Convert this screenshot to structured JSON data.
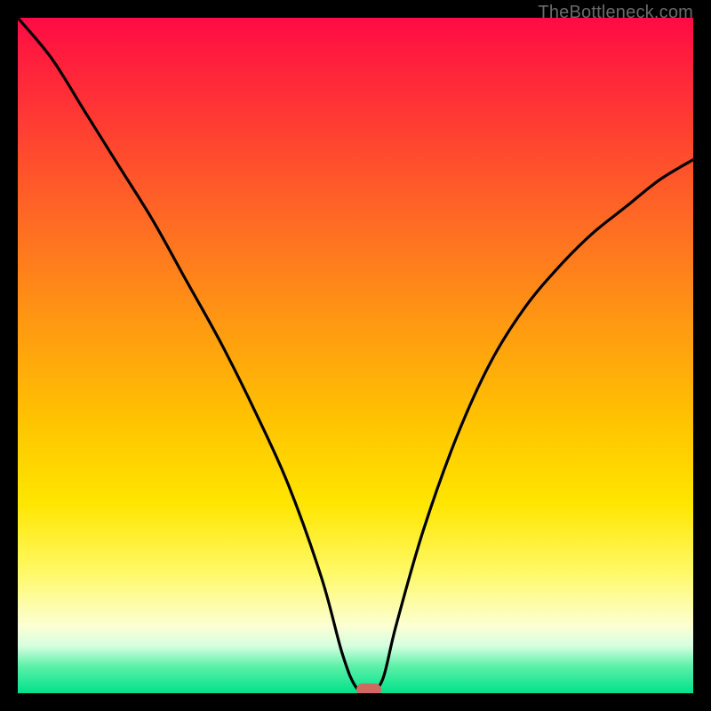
{
  "watermark": "TheBottleneck.com",
  "chart_data": {
    "type": "line",
    "title": "",
    "xlabel": "",
    "ylabel": "",
    "xlim": [
      0,
      100
    ],
    "ylim": [
      0,
      100
    ],
    "grid": false,
    "legend": false,
    "series": [
      {
        "name": "bottleneck-curve",
        "x": [
          0,
          5,
          10,
          15,
          20,
          25,
          30,
          35,
          40,
          45,
          48,
          50,
          52,
          54,
          56,
          60,
          65,
          70,
          75,
          80,
          85,
          90,
          95,
          100
        ],
        "y": [
          100,
          94,
          86,
          78,
          70,
          61,
          52,
          42,
          31,
          17,
          6,
          1,
          0,
          2,
          10,
          24,
          38,
          49,
          57,
          63,
          68,
          72,
          76,
          79
        ]
      }
    ],
    "marker": {
      "x": 52,
      "y": 0.5
    },
    "background_gradient": {
      "top": "#ff0b45",
      "mid": "#ffe600",
      "bottom": "#00e28a"
    }
  }
}
